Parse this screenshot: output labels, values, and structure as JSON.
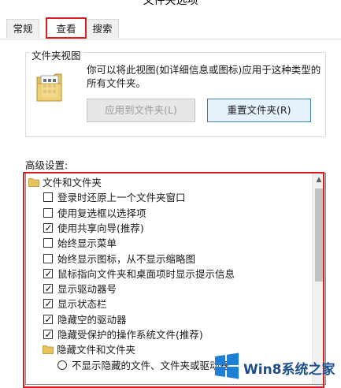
{
  "window": {
    "title": "文件夹选项"
  },
  "tabs": [
    {
      "label": "常规",
      "active": false
    },
    {
      "label": "查看",
      "active": true
    },
    {
      "label": "搜索",
      "active": false
    }
  ],
  "folder_view": {
    "legend": "文件夹视图",
    "description": "你可以将此视图(如详细信息或图标)应用于这种类型的所有文件夹。",
    "apply_button": "应用到文件夹(L)",
    "reset_button": "重置文件夹(R)"
  },
  "advanced": {
    "label": "高级设置:",
    "tree": [
      {
        "type": "folder",
        "label": "文件和文件夹",
        "indent": 0
      },
      {
        "type": "checkbox",
        "label": "登录时还原上一个文件夹窗口",
        "checked": false
      },
      {
        "type": "checkbox",
        "label": "使用复选框以选择项",
        "checked": false
      },
      {
        "type": "checkbox",
        "label": "使用共享向导(推荐)",
        "checked": true
      },
      {
        "type": "checkbox",
        "label": "始终显示菜单",
        "checked": false
      },
      {
        "type": "checkbox",
        "label": "始终显示图标，从不显示缩略图",
        "checked": false
      },
      {
        "type": "checkbox",
        "label": "鼠标指向文件夹和桌面项时显示提示信息",
        "checked": true
      },
      {
        "type": "checkbox",
        "label": "显示驱动器号",
        "checked": true
      },
      {
        "type": "checkbox",
        "label": "显示状态栏",
        "checked": true
      },
      {
        "type": "checkbox",
        "label": "隐藏空的驱动器",
        "checked": true
      },
      {
        "type": "checkbox",
        "label": "隐藏受保护的操作系统文件(推荐)",
        "checked": true
      },
      {
        "type": "folder",
        "label": "隐藏文件和文件夹",
        "indent": 1
      },
      {
        "type": "radio",
        "label": "不显示隐藏的文件、文件夹或驱动器",
        "checked": false
      }
    ]
  },
  "watermark": {
    "text": "Win8系统之家"
  },
  "colors": {
    "highlight_red": "#d81e1e",
    "folder_yellow": "#e8c35a",
    "win_blue": "#1e7fd6"
  }
}
